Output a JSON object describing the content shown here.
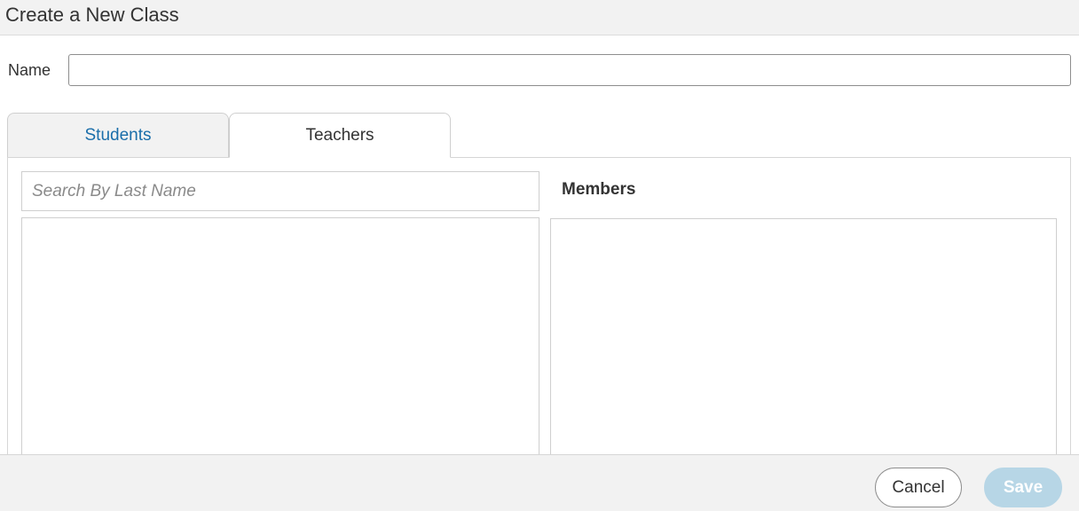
{
  "header": {
    "title": "Create a New Class"
  },
  "form": {
    "name_label": "Name",
    "name_value": "",
    "name_placeholder": ""
  },
  "tabs": [
    {
      "label": "Students",
      "active": false
    },
    {
      "label": "Teachers",
      "active": true
    }
  ],
  "search": {
    "value": "",
    "placeholder": "Search By Last Name"
  },
  "members": {
    "heading": "Members",
    "items": []
  },
  "footer": {
    "cancel_label": "Cancel",
    "save_label": "Save"
  },
  "colors": {
    "link_tab": "#1a6eaa",
    "save_disabled_bg": "#b7d6e6",
    "chrome_bg": "#f2f2f2"
  }
}
